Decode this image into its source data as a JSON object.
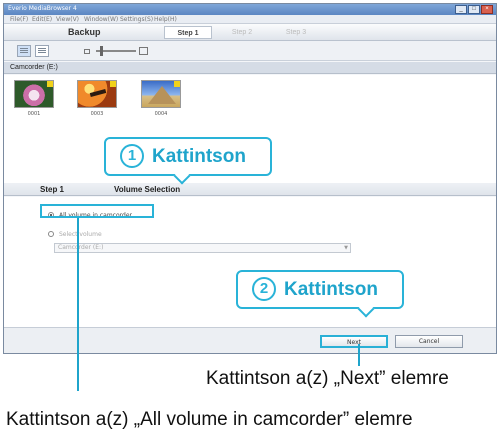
{
  "window": {
    "title": "Everio MediaBrowser 4",
    "controls": [
      "_",
      "□",
      "×"
    ]
  },
  "menu": [
    "File(F)",
    "Edit(E)",
    "View(V)",
    "Window(W)",
    "Settings(S)",
    "Help(H)"
  ],
  "header": {
    "mode": "Backup",
    "steps": [
      "Step 1",
      "Step 2",
      "Step 3"
    ],
    "active_step": 0
  },
  "source": {
    "label": "Camcorder (E:)"
  },
  "thumbnails": [
    {
      "label": "0001"
    },
    {
      "label": "0003"
    },
    {
      "label": "0004"
    }
  ],
  "step": {
    "number": "Step 1",
    "name": "Volume Selection"
  },
  "options": {
    "all": {
      "label": "All volume in camcorder",
      "selected": true
    },
    "select": {
      "label": "Select volume",
      "selected": false
    },
    "volume_value": "Camcorder (E:)"
  },
  "buttons": {
    "next": "Next",
    "cancel": "Cancel"
  },
  "callouts": [
    {
      "num": "1",
      "text": "Kattintson"
    },
    {
      "num": "2",
      "text": "Kattintson"
    }
  ],
  "captions": {
    "next": "Kattintson a(z) „Next” elemre",
    "all": "Kattintson a(z) „All volume in camcorder” elemre"
  },
  "colors": {
    "accent": "#29b3d8",
    "titlebar": "#5b86c2"
  }
}
